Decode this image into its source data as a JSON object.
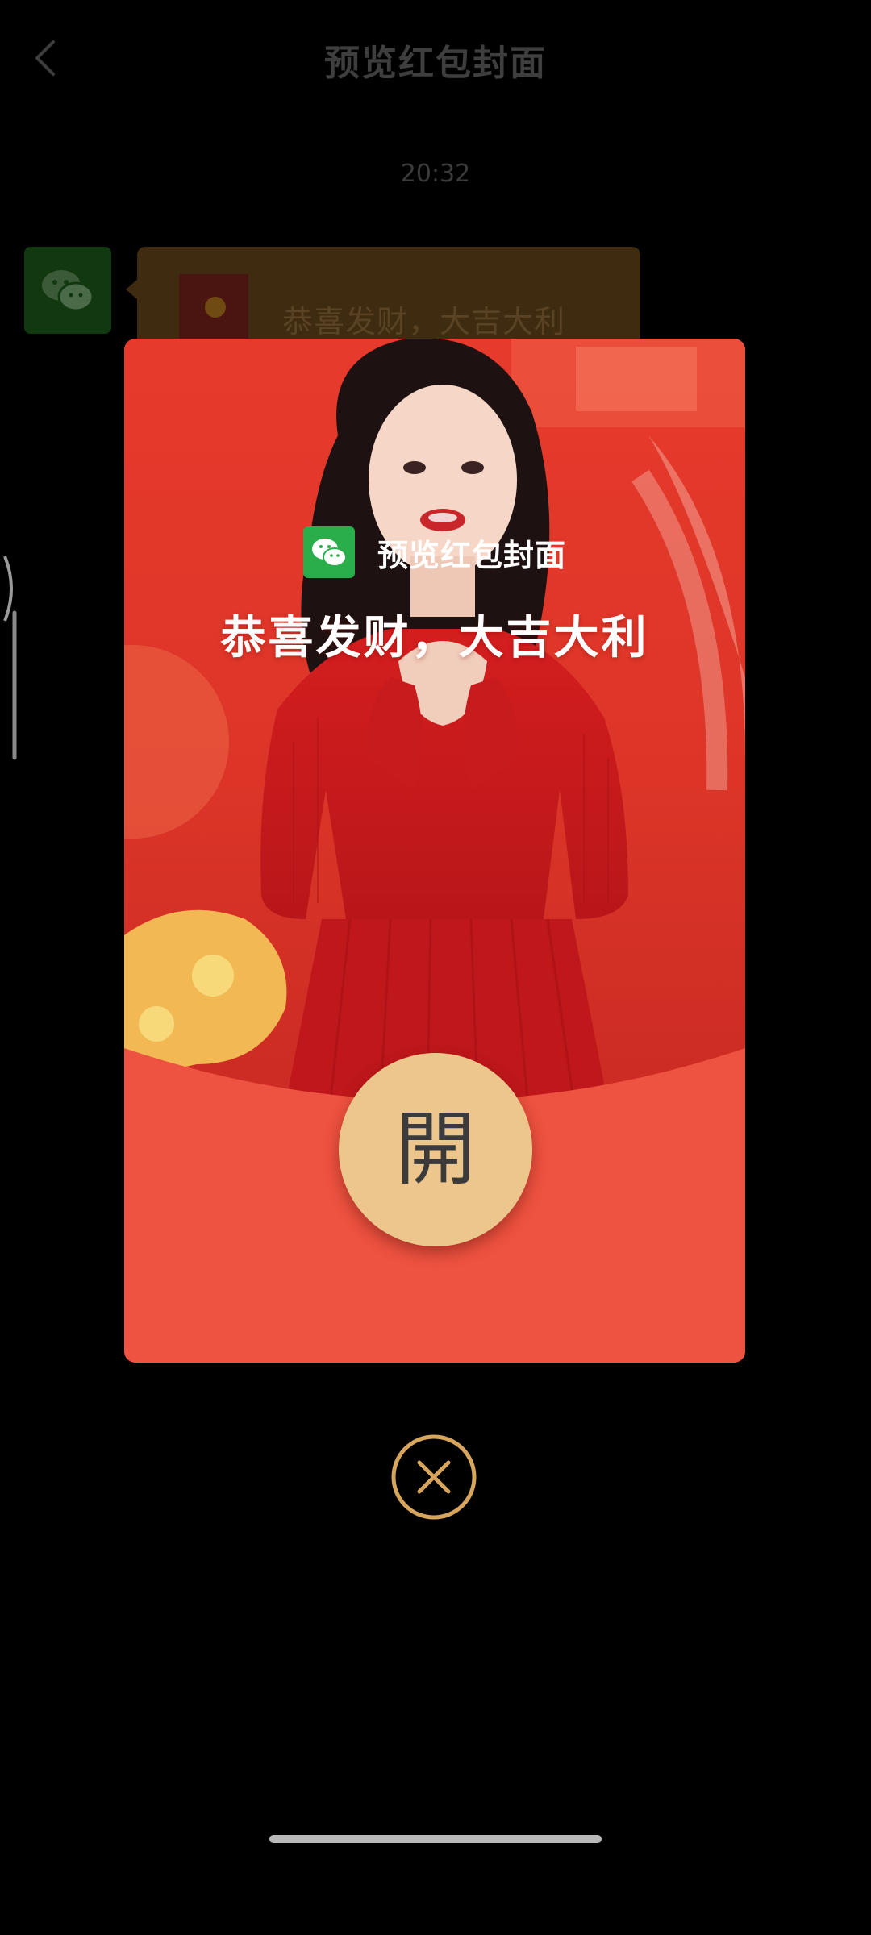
{
  "header": {
    "title": "预览红包封面"
  },
  "chat": {
    "time": "20:32",
    "message_text": "恭喜发财，大吉大利"
  },
  "cover": {
    "brand_name": "预览红包封面",
    "blessing": "恭喜发财，大吉大利",
    "open_label": "開"
  },
  "icons": {
    "back": "chevron-left-icon",
    "avatar": "wechat-icon",
    "brand_logo": "wechat-icon",
    "close": "close-circle-icon"
  },
  "colors": {
    "envelope_red": "#ee5240",
    "open_button_gold": "#edc68d",
    "close_gold": "#d7a55c",
    "wechat_green": "#2aae4c"
  }
}
